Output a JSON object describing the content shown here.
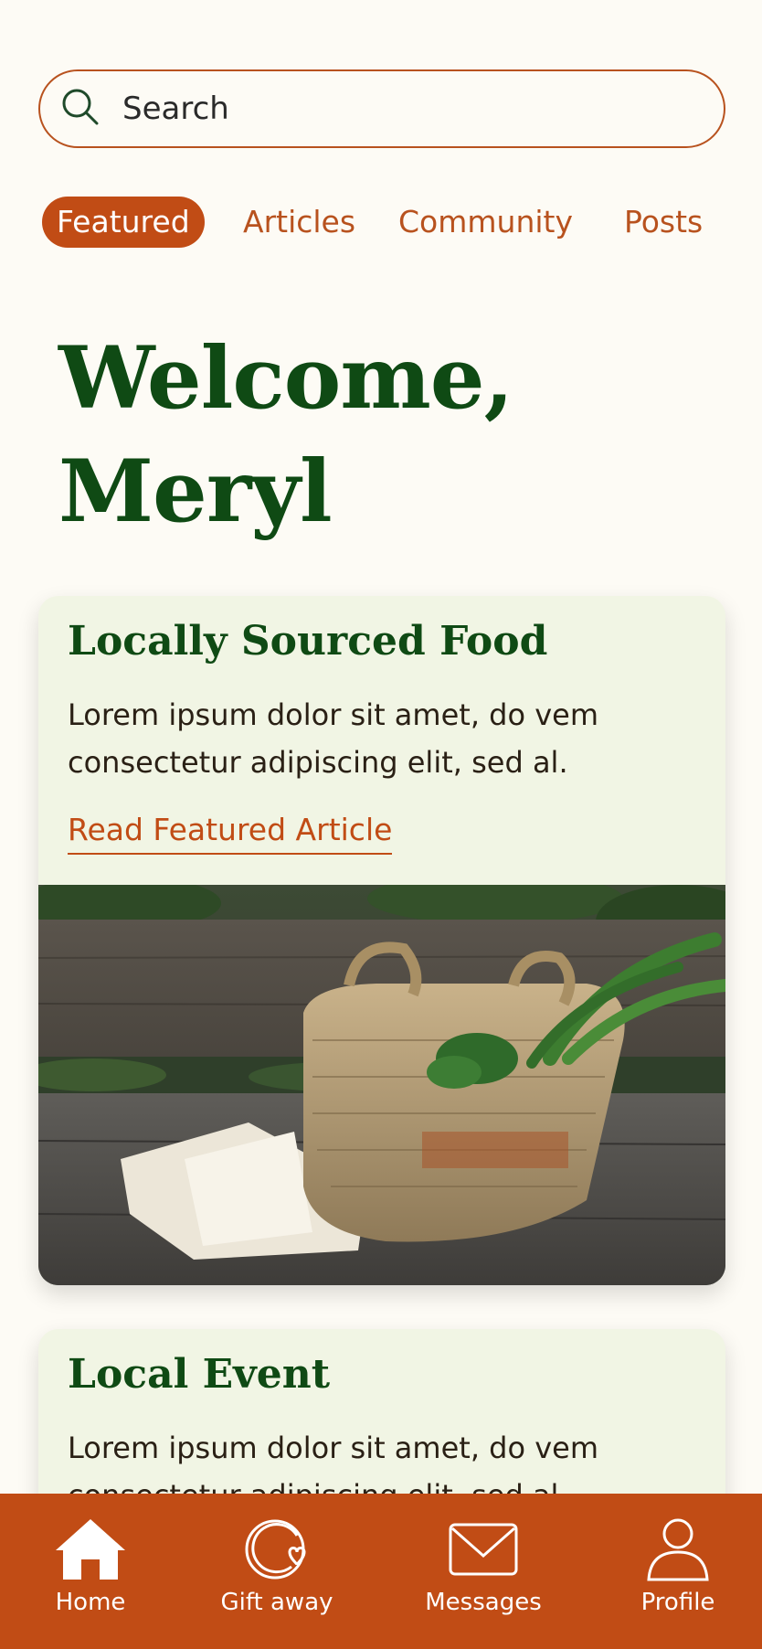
{
  "search": {
    "placeholder": "Search",
    "icon": "search-icon"
  },
  "tabs": [
    {
      "label": "Featured",
      "active": true
    },
    {
      "label": "Articles",
      "active": false
    },
    {
      "label": "Community",
      "active": false
    },
    {
      "label": "Posts",
      "active": false
    }
  ],
  "welcome": {
    "line1": "Welcome,",
    "line2": "Meryl"
  },
  "cards": [
    {
      "title": "Locally Sourced Food",
      "body": "Lorem ipsum dolor sit amet, do vem consectetur adipiscing elit, sed al.",
      "link": "Read Featured Article",
      "image": "basket-of-vegetables-photo"
    },
    {
      "title": "Local Event",
      "body": "Lorem ipsum dolor sit amet, do vem consectetur adipiscing elit, sed al."
    }
  ],
  "bottom_nav": [
    {
      "label": "Home",
      "icon": "home-icon"
    },
    {
      "label": "Gift away",
      "icon": "gift-away-icon"
    },
    {
      "label": "Messages",
      "icon": "envelope-icon"
    },
    {
      "label": "Profile",
      "icon": "profile-icon"
    }
  ],
  "colors": {
    "background": "#fdfbf5",
    "accent": "#c14c15",
    "heading_green": "#0f4a14",
    "card_bg": "#f1f5e4"
  }
}
